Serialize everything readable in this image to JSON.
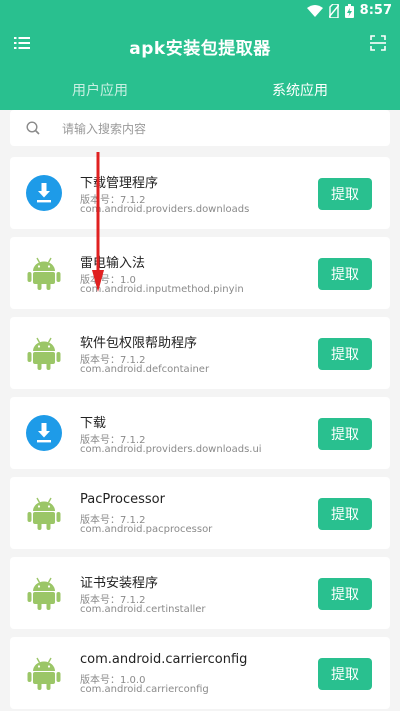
{
  "status_bar": {
    "time": "8:57"
  },
  "header": {
    "title": "apk安装包提取器",
    "tabs": [
      {
        "label": "用户应用",
        "active": false
      },
      {
        "label": "系统应用",
        "active": true
      }
    ]
  },
  "search": {
    "placeholder": "请输入搜索内容"
  },
  "apps": [
    {
      "name": "下载管理程序",
      "version": "版本号：7.1.2",
      "package": "com.android.providers.downloads",
      "icon": "download-icon",
      "button": "提取"
    },
    {
      "name": "雷电输入法",
      "version": "版本号：1.0",
      "package": "com.android.inputmethod.pinyin",
      "icon": "android-icon",
      "button": "提取"
    },
    {
      "name": "软件包权限帮助程序",
      "version": "版本号：7.1.2",
      "package": "com.android.defcontainer",
      "icon": "android-icon",
      "button": "提取"
    },
    {
      "name": "下载",
      "version": "版本号：7.1.2",
      "package": "com.android.providers.downloads.ui",
      "icon": "download-icon",
      "button": "提取"
    },
    {
      "name": "PacProcessor",
      "version": "版本号：7.1.2",
      "package": "com.android.pacprocessor",
      "icon": "android-icon",
      "button": "提取"
    },
    {
      "name": "证书安装程序",
      "version": "版本号：7.1.2",
      "package": "com.android.certinstaller",
      "icon": "android-icon",
      "button": "提取"
    },
    {
      "name": "com.android.carrierconfig",
      "version": "版本号：1.0.0",
      "package": "com.android.carrierconfig",
      "icon": "android-icon",
      "button": "提取"
    }
  ],
  "colors": {
    "accent": "#29c08f",
    "download_icon": "#1e9be8",
    "android_icon": "#9bc667",
    "arrow": "#e02020"
  }
}
